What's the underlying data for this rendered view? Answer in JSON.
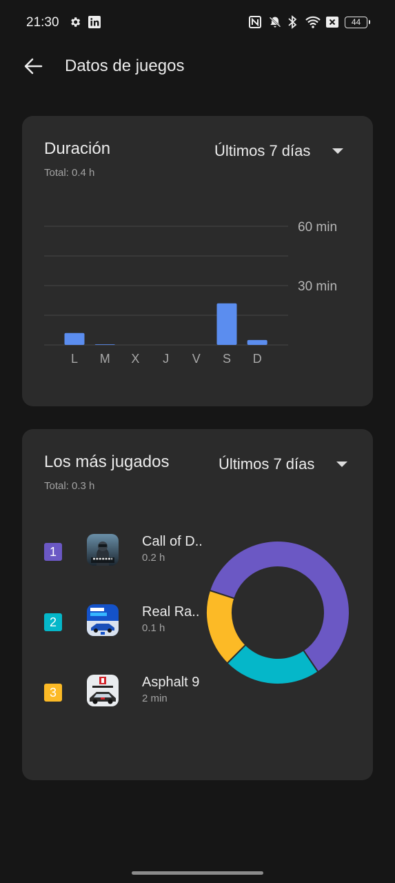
{
  "status_bar": {
    "time": "21:30",
    "battery": "44",
    "icons": [
      "gear-icon",
      "linkedin-icon",
      "nfc-icon",
      "bell-off-icon",
      "bluetooth-icon",
      "wifi-icon",
      "no-sim-icon",
      "battery-icon"
    ]
  },
  "header": {
    "title": "Datos de juegos",
    "back_icon": "arrow-left-icon"
  },
  "duration_card": {
    "title": "Duración",
    "total": "Total: 0.4 h",
    "period": "Últimos 7 días"
  },
  "most_played_card": {
    "title": "Los más jugados",
    "total": "Total: 0.3 h",
    "period": "Últimos 7 días",
    "games": [
      {
        "rank": "1",
        "name": "Call of D..",
        "time": "0.2 h",
        "color": "#6b58c4",
        "icon": "call-of-duty-app-icon"
      },
      {
        "rank": "2",
        "name": "Real Ra..",
        "time": "0.1 h",
        "color": "#05b7c9",
        "icon": "real-racing-app-icon"
      },
      {
        "rank": "3",
        "name": "Asphalt 9",
        "time": "2 min",
        "color": "#fcba26",
        "icon": "asphalt-9-app-icon"
      }
    ]
  },
  "chart_data": [
    {
      "type": "bar",
      "categories": [
        "L",
        "M",
        "X",
        "J",
        "V",
        "S",
        "D"
      ],
      "values": [
        6,
        0.3,
        0,
        0,
        0,
        21,
        2.5
      ],
      "ylabel": "",
      "ytick_labels": [
        "30 min",
        "60 min"
      ],
      "ytick_values": [
        30,
        60
      ],
      "ylim": [
        0,
        60
      ],
      "grid": true,
      "color": "#5b8def"
    },
    {
      "type": "pie",
      "donut": true,
      "categories": [
        "Call of D..",
        "Real Ra..",
        "Asphalt 9"
      ],
      "values": [
        0.2,
        0.1,
        2
      ],
      "percentages": [
        60.5,
        22,
        17.5
      ],
      "colors": [
        "#6b58c4",
        "#05b7c9",
        "#fcba26"
      ]
    }
  ]
}
